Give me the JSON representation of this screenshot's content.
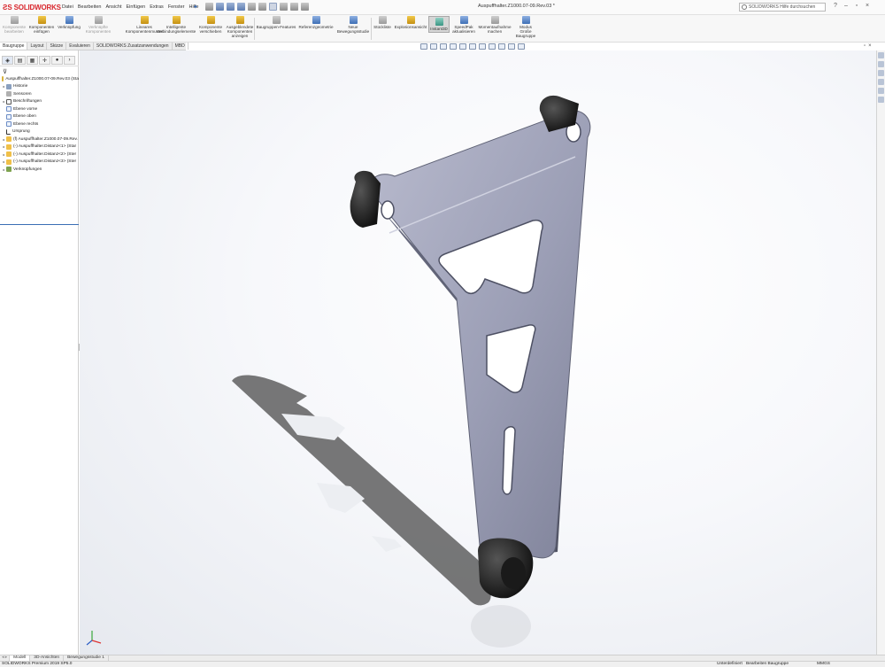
{
  "app": {
    "logo_text": "SOLIDWORKS",
    "doc_title": "Auspuffhalter.Z1000.07-09.Rev.03 *",
    "search_placeholder": "SOLIDWORKS Hilfe durchsuchen",
    "menus": [
      "Datei",
      "Bearbeiten",
      "Ansicht",
      "Einfügen",
      "Extras",
      "Fenster",
      "Hilfe"
    ]
  },
  "commands": [
    {
      "label": "Komponente bearbeiten",
      "disabled": true
    },
    {
      "label": "Komponenten einfügen",
      "disabled": false
    },
    {
      "label": "Verknüpfung",
      "disabled": false
    },
    {
      "label": "Verknüpfte Komponenten",
      "disabled": true
    },
    {
      "label": "Lineares Komponentenmuster",
      "disabled": false
    },
    {
      "label": "Intelligente Verbindungselemente",
      "disabled": false
    },
    {
      "label": "Komponente verschieben",
      "disabled": false
    },
    {
      "label": "Ausgeblendete Komponenten anzeigen",
      "disabled": false
    },
    {
      "label": "Baugruppen-Features",
      "disabled": false
    },
    {
      "label": "Referenzgeometrie",
      "disabled": false
    },
    {
      "label": "Neue Bewegungsstudie",
      "disabled": false
    },
    {
      "label": "Stückliste",
      "disabled": false
    },
    {
      "label": "Explosionsansicht",
      "disabled": false
    },
    {
      "label": "Instant3D",
      "disabled": false,
      "selected": true
    },
    {
      "label": "SpeedPak aktualisieren",
      "disabled": false
    },
    {
      "label": "Momentaufnahme machen",
      "disabled": false
    },
    {
      "label": "Modus Große Baugruppe",
      "disabled": false
    }
  ],
  "cmd_tabs": [
    "Baugruppe",
    "Layout",
    "Skizze",
    "Evaluieren",
    "SOLIDWORKS Zusatzanwendungen",
    "MBD"
  ],
  "active_cmd_tab": "Baugruppe",
  "tree": {
    "items": [
      {
        "label": "Auspuffhalter.Z1000.07-09.Rev.03 (Sta",
        "icon": "assembly-icon",
        "expand": "",
        "indent": 0
      },
      {
        "label": "Historie",
        "icon": "history-icon",
        "expand": "▸",
        "indent": 1
      },
      {
        "label": "Sensoren",
        "icon": "sensor-icon",
        "expand": "",
        "indent": 1
      },
      {
        "label": "Beschriftungen",
        "icon": "annotation-icon",
        "expand": "▸",
        "indent": 1
      },
      {
        "label": "Ebene vorne",
        "icon": "plane-icon",
        "expand": "",
        "indent": 1
      },
      {
        "label": "Ebene oben",
        "icon": "plane-icon",
        "expand": "",
        "indent": 1
      },
      {
        "label": "Ebene rechts",
        "icon": "plane-icon",
        "expand": "",
        "indent": 1
      },
      {
        "label": "Ursprung",
        "icon": "origin-icon",
        "expand": "",
        "indent": 1
      },
      {
        "label": "(f) Auspuffhalter.Z1000.07-09.Rev.",
        "icon": "part-icon",
        "expand": "▸",
        "indent": 1
      },
      {
        "label": "(-) Auspuffhalter.Distanz<1> (Star",
        "icon": "part-icon",
        "expand": "▸",
        "indent": 1
      },
      {
        "label": "(-) Auspuffhalter.Distanz<2> (Ster",
        "icon": "part-icon",
        "expand": "▸",
        "indent": 1
      },
      {
        "label": "(-) Auspuffhalter.Distanz<3> (Ster",
        "icon": "part-icon",
        "expand": "▸",
        "indent": 1
      },
      {
        "label": "Verknüpfungen",
        "icon": "mate-icon",
        "expand": "▸",
        "indent": 1
      }
    ]
  },
  "bottom_tabs": [
    "Modell",
    "3D-Ansichten",
    "Bewegungsstudie 1"
  ],
  "active_bottom_tab": "Modell",
  "status": {
    "left": "SOLIDWORKS Premium 2019 SP5.0",
    "state": "Unterdefiniert",
    "mode": "Bearbeiten Baugruppe",
    "units": "MMGS"
  },
  "colors": {
    "brand": "#d8262c",
    "part": "#9c9fb6",
    "spacer": "#2a2a2a",
    "selection": "#3b6fb5"
  }
}
